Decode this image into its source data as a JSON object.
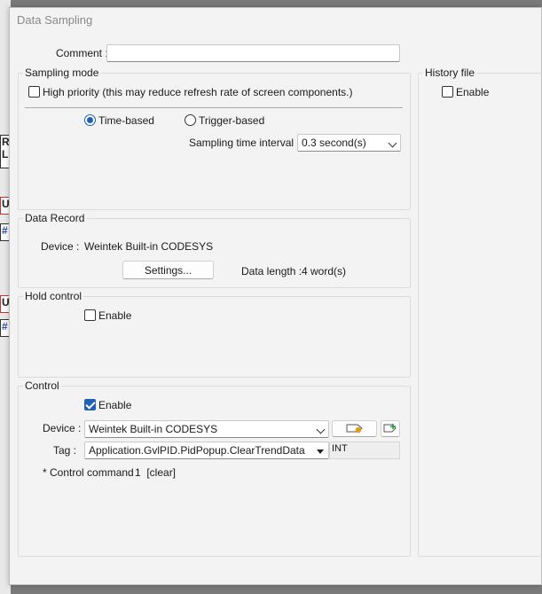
{
  "dialog": {
    "title": "Data Sampling"
  },
  "comment": {
    "label": "Comment :",
    "value": ""
  },
  "sampling_mode": {
    "title": "Sampling mode",
    "high_priority_label": "High priority (this may reduce refresh rate of screen components.)",
    "high_priority_checked": false,
    "time_based_label": "Time-based",
    "trigger_based_label": "Trigger-based",
    "selected_mode": "Time-based",
    "interval_label": "Sampling time interval :",
    "interval_value": "0.3 second(s)"
  },
  "history_file": {
    "title": "History file",
    "enable_label": "Enable",
    "enabled": false
  },
  "data_record": {
    "title": "Data Record",
    "device_label": "Device :",
    "device_value": "Weintek Built-in CODESYS",
    "settings_button": "Settings...",
    "data_length_label": "Data length :",
    "data_length_value": "4 word(s)"
  },
  "hold_control": {
    "title": "Hold control",
    "enable_label": "Enable",
    "enabled": false
  },
  "control": {
    "title": "Control",
    "enable_label": "Enable",
    "enabled": true,
    "device_label": "Device :",
    "device_value": "Weintek Built-in CODESYS",
    "tag_label": "Tag :",
    "tag_value": "Application.GvlPID.PidPopup.ClearTrendData",
    "tag_type": "INT",
    "command_label": "* Control command :",
    "command_value": "1  [clear]"
  },
  "background_fragments": [
    "R",
    "L",
    "U",
    "#",
    "U",
    "#"
  ],
  "colors": {
    "accent": "#1f5fb8",
    "dialog_bg": "#f3f3f3",
    "title_text": "#8a8a8a"
  },
  "icons": [
    "tag-settings-icon",
    "add-tag-icon"
  ]
}
